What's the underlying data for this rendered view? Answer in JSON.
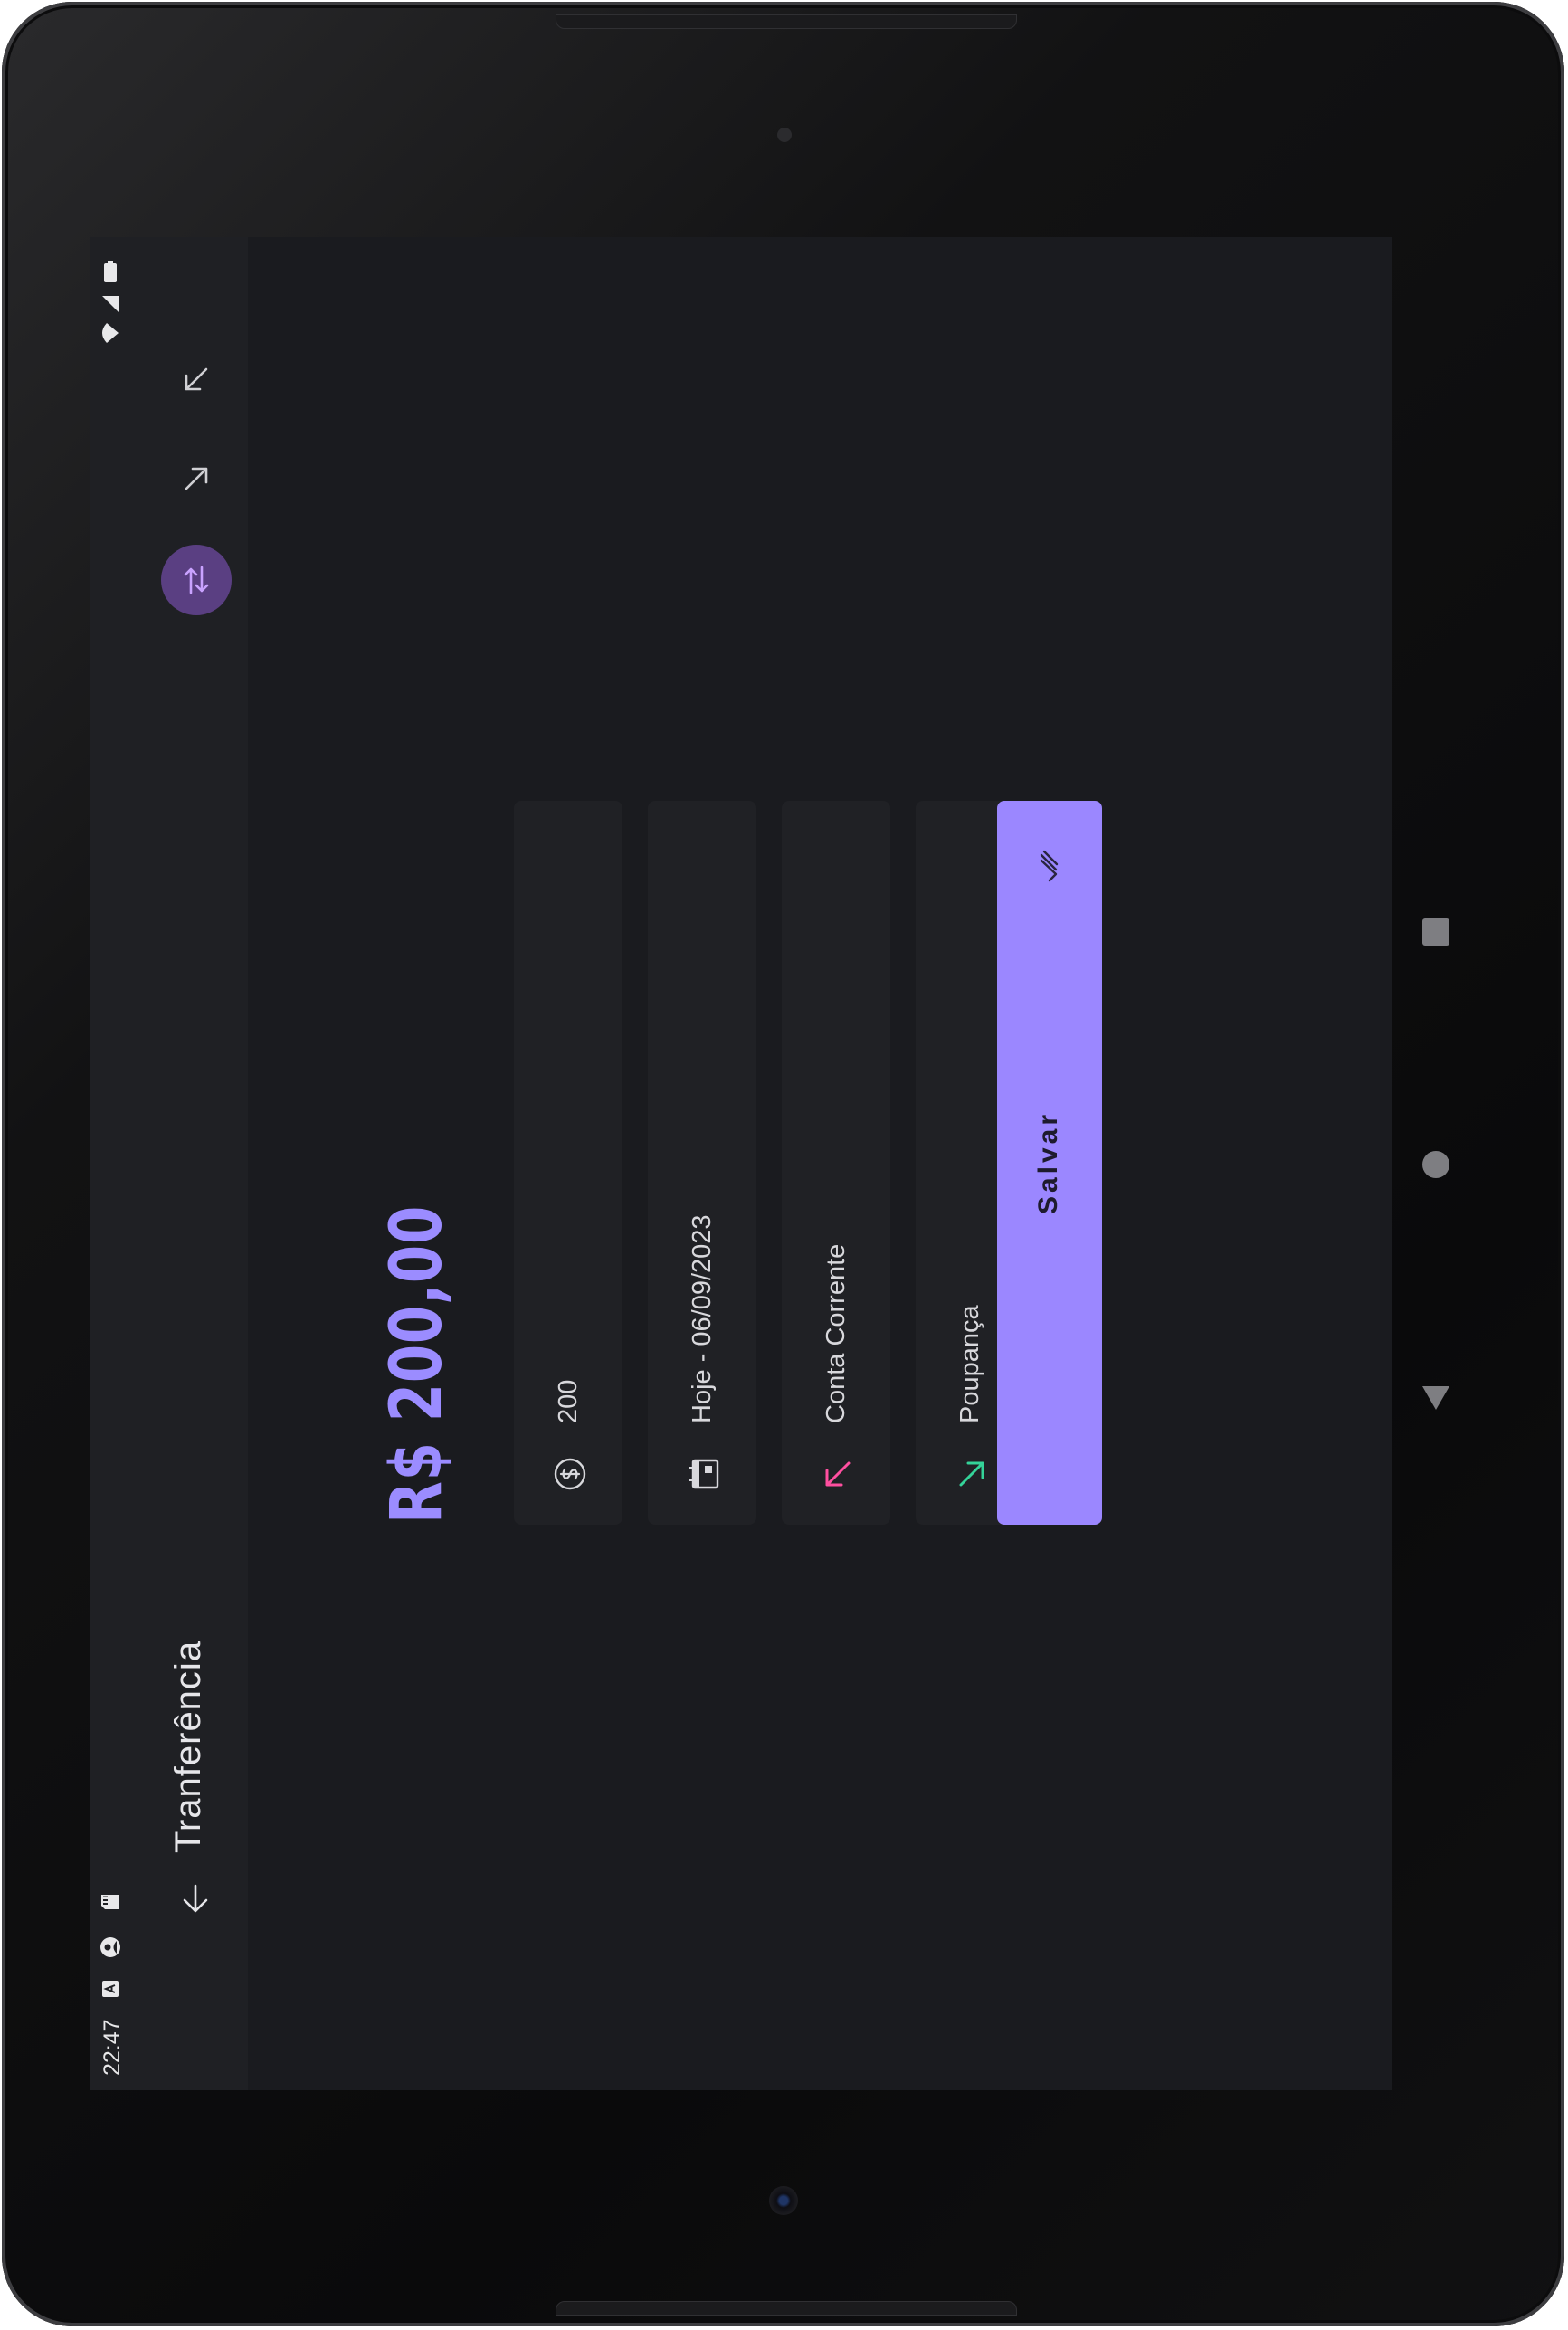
{
  "status_bar": {
    "time": "22:47"
  },
  "app_bar": {
    "title": "Tranferência",
    "actions": [
      "income-arrow-icon",
      "expense-arrow-icon",
      "transfer-icon"
    ]
  },
  "amount_display": "R$ 200,00",
  "form": {
    "value_field": {
      "icon": "dollar-circle-icon",
      "value": "200"
    },
    "date_field": {
      "icon": "calendar-icon",
      "value": "Hoje - 06/09/2023"
    },
    "from_account_field": {
      "icon": "arrow-up-left-icon",
      "value": "Conta Corrente",
      "icon_color": "#ff4fa0"
    },
    "to_account_field": {
      "icon": "arrow-down-right-icon",
      "value": "Poupança",
      "icon_color": "#34d399"
    },
    "save_button_label": "Salvar"
  },
  "colors": {
    "accent": "#9b87ff",
    "amount_text": "#9b8cff",
    "active_tab_bg": "#5a3f82",
    "background": "#1a1b1f"
  }
}
